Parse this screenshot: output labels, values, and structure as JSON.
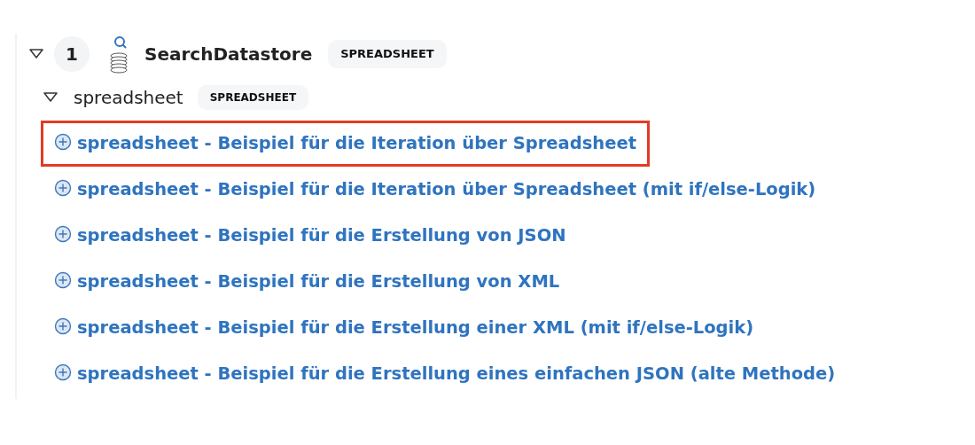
{
  "tree": [
    {
      "expanded": true,
      "number": "1",
      "label": "SearchDatastore",
      "badge": "SPREADSHEET",
      "children": [
        {
          "expanded": true,
          "label": "spreadsheet",
          "badge": "SPREADSHEET",
          "children": [
            {
              "label": "spreadsheet - Beispiel für die Iteration über Spreadsheet",
              "highlighted": true
            },
            {
              "label": "spreadsheet - Beispiel für die Iteration über Spreadsheet (mit if/else-Logik)",
              "highlighted": false
            },
            {
              "label": "spreadsheet - Beispiel für die Erstellung von JSON",
              "highlighted": false
            },
            {
              "label": "spreadsheet - Beispiel für die Erstellung von XML",
              "highlighted": false
            },
            {
              "label": "spreadsheet - Beispiel für die Erstellung einer XML (mit if/else-Logik)",
              "highlighted": false
            },
            {
              "label": "spreadsheet - Beispiel für die Erstellung eines einfachen JSON (alte Methode)",
              "highlighted": false
            }
          ]
        }
      ]
    }
  ]
}
